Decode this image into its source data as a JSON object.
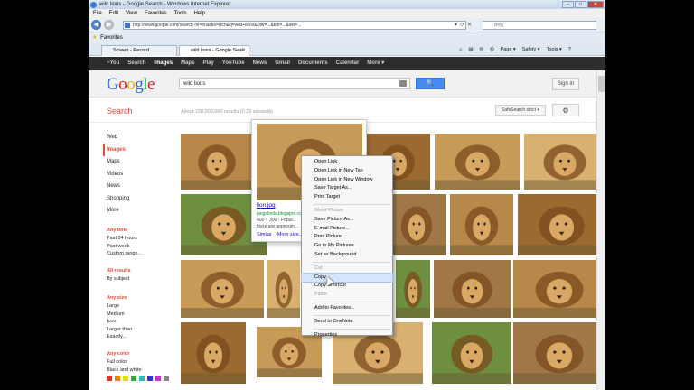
{
  "window": {
    "title": "wild lions - Google Search - Windows Internet Explorer",
    "buttons": {
      "minimize": "–",
      "maximize": "□",
      "close": "✕"
    }
  },
  "menubar": [
    "File",
    "Edit",
    "View",
    "Favorites",
    "Tools",
    "Help"
  ],
  "address": {
    "url": "http://www.google.com/search?hl=en&tbs=isch&q=wild+lions&biw=...&bih=...&sei=...",
    "search_placeholder": "Bing",
    "go_glyph": "⌕"
  },
  "favorites": {
    "label": "Favorites"
  },
  "tabs": [
    {
      "label": "Screen - Record"
    },
    {
      "label": "wild lions - Google Sear...",
      "active": true
    }
  ],
  "ie_commands": [
    "Page ▾",
    "Safety ▾",
    "Tools ▾"
  ],
  "google_bar": [
    "+You",
    "Search",
    "Images",
    "Maps",
    "Play",
    "YouTube",
    "News",
    "Gmail",
    "Documents",
    "Calendar",
    "More ▾"
  ],
  "google_bar_active": "Images",
  "search": {
    "query": "wild lions",
    "button_icon": "🔍",
    "signin": "Sign in"
  },
  "toolbar": {
    "label": "Search",
    "results": "About 158,000,000 results (0.23 seconds)",
    "safesearch": "SafeSearch strict ▾",
    "gear": "⚙"
  },
  "sidebar": {
    "items": [
      "Web",
      "Images",
      "Maps",
      "Videos",
      "News",
      "Shopping",
      "More"
    ],
    "active": "Images"
  },
  "filters": [
    {
      "heading": "Any time",
      "options": [
        "Past 24 hours",
        "Past week",
        "Custom range..."
      ]
    },
    {
      "heading": "All results",
      "options": [
        "By subject"
      ]
    },
    {
      "heading": "Any size",
      "options": [
        "Large",
        "Medium",
        "Icon",
        "Larger than...",
        "Exactly..."
      ]
    },
    {
      "heading": "Any color",
      "options": [
        "Full color",
        "Black and white"
      ]
    }
  ],
  "color_swatches": [
    "#d33",
    "#e80",
    "#dd0",
    "#3a3",
    "#3bb",
    "#33c",
    "#c3c",
    "#888"
  ],
  "hovercard": {
    "filename": "lion.jpg",
    "site": "jangalinda.blogspot.com",
    "dims": "400 × 300 - Popul...",
    "desc": "there are approxim...",
    "links": [
      "Similar",
      "More size..."
    ]
  },
  "context_menu": [
    {
      "label": "Open Link"
    },
    {
      "label": "Open Link in New Tab"
    },
    {
      "label": "Open Link in New Window"
    },
    {
      "label": "Save Target As..."
    },
    {
      "label": "Print Target"
    },
    {
      "sep": true
    },
    {
      "label": "Show Picture",
      "disabled": true
    },
    {
      "label": "Save Picture As..."
    },
    {
      "label": "E-mail Picture..."
    },
    {
      "label": "Print Picture..."
    },
    {
      "label": "Go to My Pictures"
    },
    {
      "label": "Set as Background"
    },
    {
      "sep": true
    },
    {
      "label": "Cut",
      "disabled": true
    },
    {
      "label": "Copy",
      "highlighted": true
    },
    {
      "label": "Copy Shortcut"
    },
    {
      "label": "Paste",
      "disabled": true
    },
    {
      "sep": true
    },
    {
      "label": "Add to Favorites..."
    },
    {
      "sep": true
    },
    {
      "label": "Send to OneNote"
    },
    {
      "sep": true
    },
    {
      "label": "Properties"
    }
  ],
  "image_tone_colors": [
    "#b8884a",
    "#9a6a30",
    "#c89a58",
    "#d8b070",
    "#6f8f40",
    "#a07848"
  ]
}
